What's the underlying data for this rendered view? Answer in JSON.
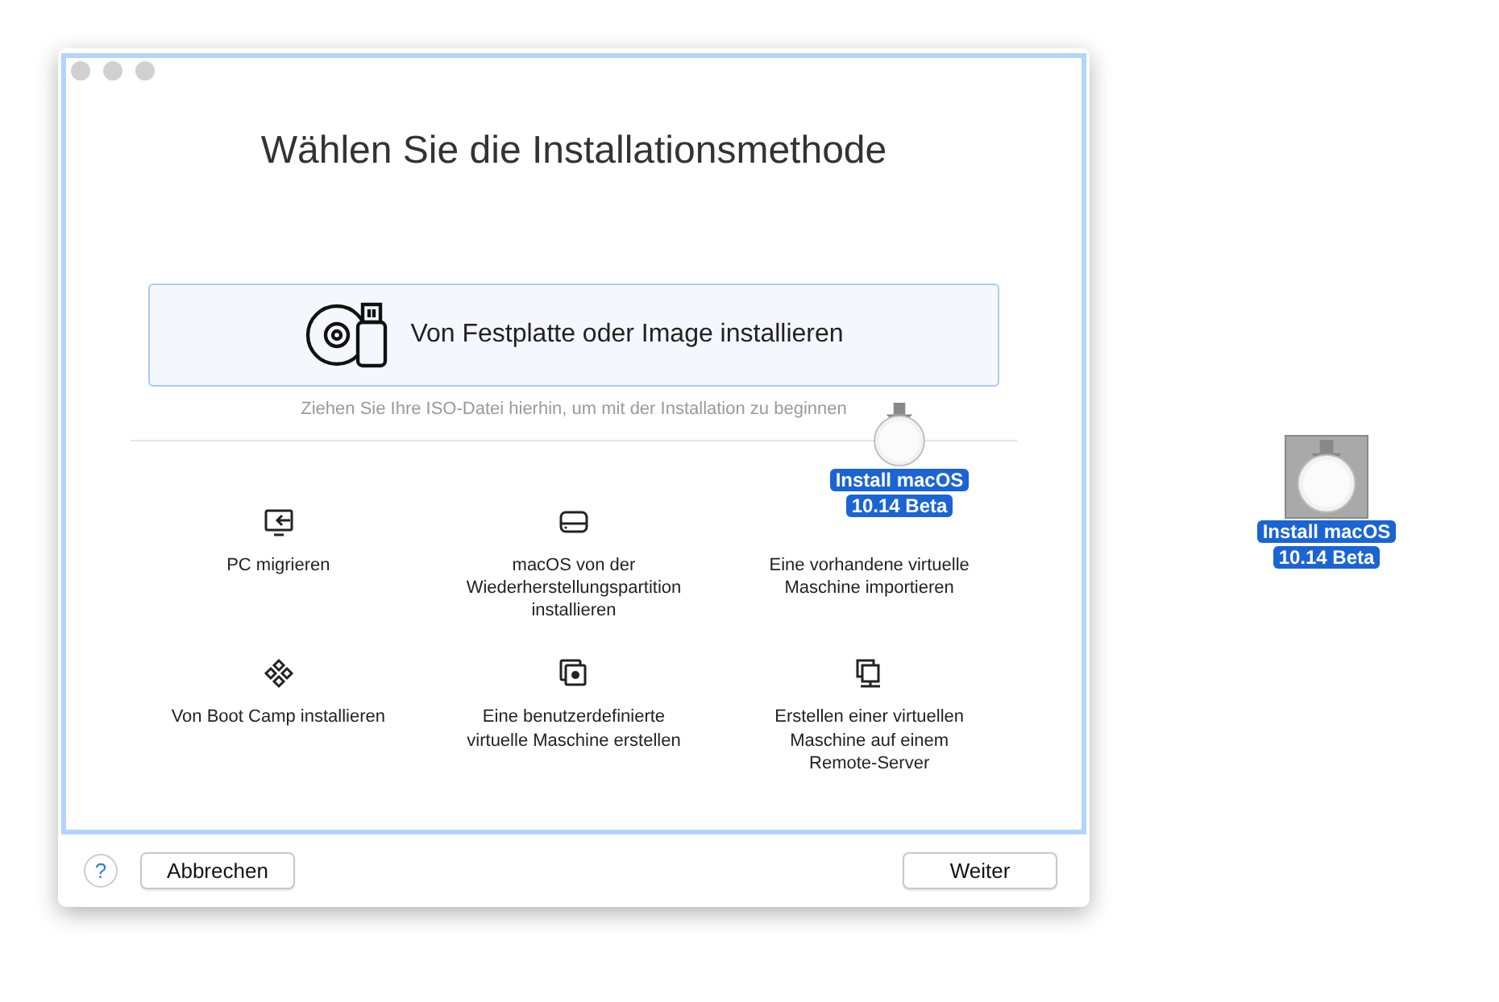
{
  "window": {
    "title": "Wählen Sie die Installationsmethode",
    "drop_target_highlighted": true
  },
  "drop_zone": {
    "label": "Von Festplatte oder Image installieren",
    "hint": "Ziehen Sie Ihre ISO-Datei hierhin, um mit der Installation zu beginnen"
  },
  "options": [
    {
      "kind": "migrate",
      "label": "PC migrieren"
    },
    {
      "kind": "recovery",
      "label": "macOS von der\nWiederherstellungspartition\ninstallieren"
    },
    {
      "kind": "import",
      "label": "Eine vorhandene virtuelle\nMaschine importieren"
    },
    {
      "kind": "bootcamp",
      "label": "Von Boot Camp installieren"
    },
    {
      "kind": "custom",
      "label": "Eine benutzerdefinierte\nvirtuelle Maschine erstellen"
    },
    {
      "kind": "remote",
      "label": "Erstellen einer virtuellen\nMaschine auf einem\nRemote-Server"
    }
  ],
  "footer": {
    "help": "?",
    "cancel": "Abbrechen",
    "next": "Weiter"
  },
  "dragged_item": {
    "label": "Install macOS\n10.14 Beta"
  },
  "desktop_icon": {
    "label": "Install macOS\n10.14 Beta",
    "selected": true
  }
}
